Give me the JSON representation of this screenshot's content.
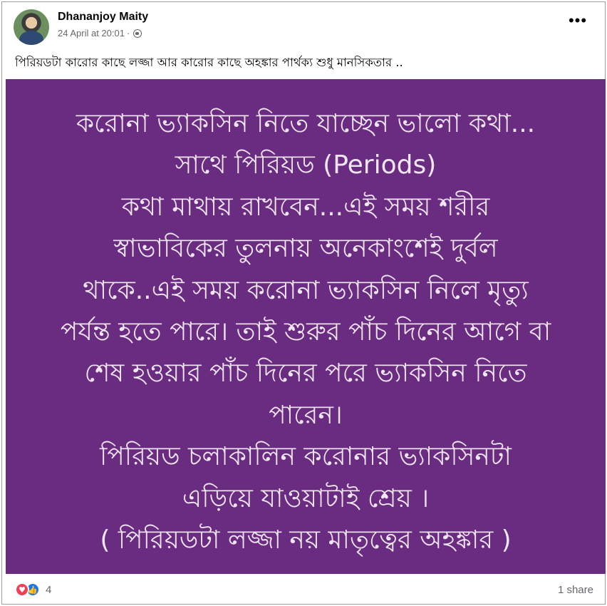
{
  "post": {
    "author": "Dhananjoy Maity",
    "timestamp": "24 April at 20:01",
    "separator": "·",
    "privacy_icon": "globe-icon",
    "more_label": "•••",
    "caption": "পিরিয়ডটা কারোর কাছে লজ্জা আর কারোর কাছে অহঙ্কার পার্থক্য শুধু মানসিকতার ..",
    "image": {
      "background": "#6a2c81",
      "text_color": "#f1e6f6",
      "lines": [
        "করোনা ভ্যাকসিন নিতে যাচ্ছেন ভালো কথা...",
        "সাথে পিরিয়ড (Periods)",
        "কথা মাথায় রাখবেন...এই সময় শরীর",
        "স্বাভাবিকের তুলনায় অনেকাংশেই দুর্বল",
        "থাকে..এই সময় করোনা ভ্যাকসিন নিলে মৃত্যু",
        "পর্যন্ত হতে পারে। তাই শুরুর পাঁচ দিনের আগে বা",
        "শেষ হওয়ার পাঁচ দিনের পরে ভ্যাকসিন নিতে",
        "পারেন।",
        "পিরিয়ড চলাকালিন করোনার ভ্যাকসিনটা",
        "এড়িয়ে যাওয়াটাই শ্রেয় ।",
        "( পিরিয়ডটা লজ্জা নয় মাতৃত্বের অহঙ্কার )"
      ]
    },
    "reactions": {
      "icons": [
        "love-icon",
        "like-icon"
      ],
      "count": "4"
    },
    "shares": "1 share"
  }
}
